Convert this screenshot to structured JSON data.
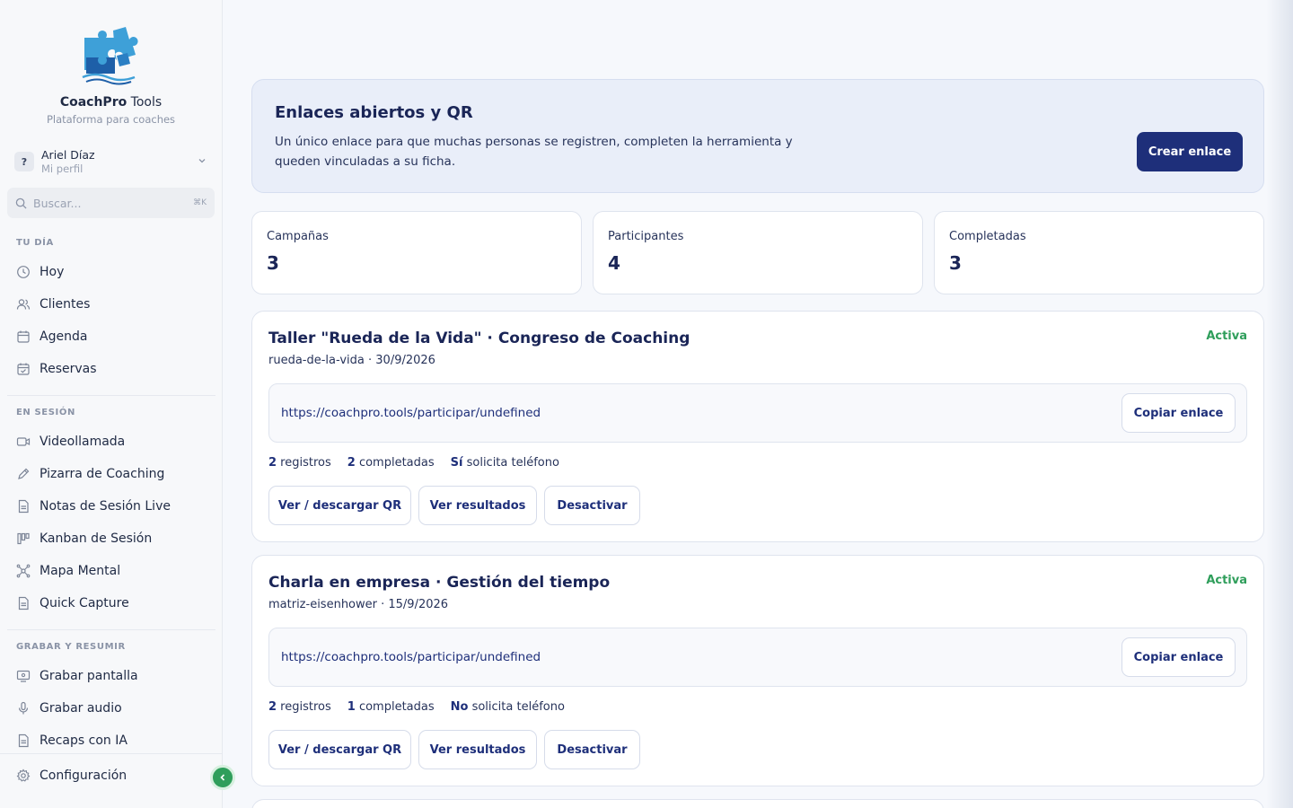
{
  "brand": {
    "name_bold": "CoachPro",
    "name_rest": " Tools",
    "tagline": "Plataforma para coaches"
  },
  "profile": {
    "avatar": "?",
    "name": "Ariel Díaz",
    "subtitle": "Mi perfil",
    "chevron_icon": "chevron-down-icon"
  },
  "search": {
    "placeholder": "Buscar...",
    "shortcut": "⌘K"
  },
  "nav": {
    "day": {
      "heading": "TU DÍA",
      "items": [
        {
          "label": "Hoy",
          "icon": "clock-icon"
        },
        {
          "label": "Clientes",
          "icon": "users-icon"
        },
        {
          "label": "Agenda",
          "icon": "calendar-icon"
        },
        {
          "label": "Reservas",
          "icon": "calendar-check-icon"
        }
      ]
    },
    "session": {
      "heading": "EN SESIÓN",
      "items": [
        {
          "label": "Videollamada",
          "icon": "video-icon"
        },
        {
          "label": "Pizarra de Coaching",
          "icon": "pen-icon"
        },
        {
          "label": "Notas de Sesión Live",
          "icon": "document-icon"
        },
        {
          "label": "Kanban de Sesión",
          "icon": "kanban-icon"
        },
        {
          "label": "Mapa Mental",
          "icon": "mindmap-icon"
        },
        {
          "label": "Quick Capture",
          "icon": "document-icon"
        }
      ]
    },
    "record": {
      "heading": "GRABAR Y RESUMIR",
      "items": [
        {
          "label": "Grabar pantalla",
          "icon": "monitor-icon"
        },
        {
          "label": "Grabar audio",
          "icon": "microphone-icon"
        },
        {
          "label": "Recaps con IA",
          "icon": "document-icon"
        }
      ]
    },
    "settings": {
      "label": "Configuración",
      "icon": "gear-icon"
    }
  },
  "hero": {
    "title": "Enlaces abiertos y QR",
    "description": "Un único enlace para que muchas personas se registren, completen la herramienta y queden vinculadas a su ficha.",
    "button": "Crear enlace"
  },
  "stats": [
    {
      "label": "Campañas",
      "value": "3"
    },
    {
      "label": "Participantes",
      "value": "4"
    },
    {
      "label": "Completadas",
      "value": "3"
    }
  ],
  "campaigns": [
    {
      "title": "Taller \"Rueda de la Vida\" · Congreso de Coaching",
      "status": "Activa",
      "subtitle": "rueda-de-la-vida · 30/9/2026",
      "url": "https://coachpro.tools/participar/undefined",
      "copy_button": "Copiar enlace",
      "registros_num": "2",
      "registros_label": " registros",
      "completadas_num": "2",
      "completadas_label": " completadas",
      "phone_flag": "Sí",
      "phone_label": " solicita teléfono",
      "btn_qr": "Ver / descargar QR",
      "btn_results": "Ver resultados",
      "btn_deactivate": "Desactivar"
    },
    {
      "title": "Charla en empresa · Gestión del tiempo",
      "status": "Activa",
      "subtitle": "matriz-eisenhower · 15/9/2026",
      "url": "https://coachpro.tools/participar/undefined",
      "copy_button": "Copiar enlace",
      "registros_num": "2",
      "registros_label": " registros",
      "completadas_num": "1",
      "completadas_label": " completadas",
      "phone_flag": "No",
      "phone_label": " solicita teléfono",
      "btn_qr": "Ver / descargar QR",
      "btn_results": "Ver resultados",
      "btn_deactivate": "Desactivar"
    }
  ],
  "colors": {
    "primary": "#1e2f7a",
    "accent_green": "#2f9e5b",
    "hero_bg": "#e9eef9"
  }
}
